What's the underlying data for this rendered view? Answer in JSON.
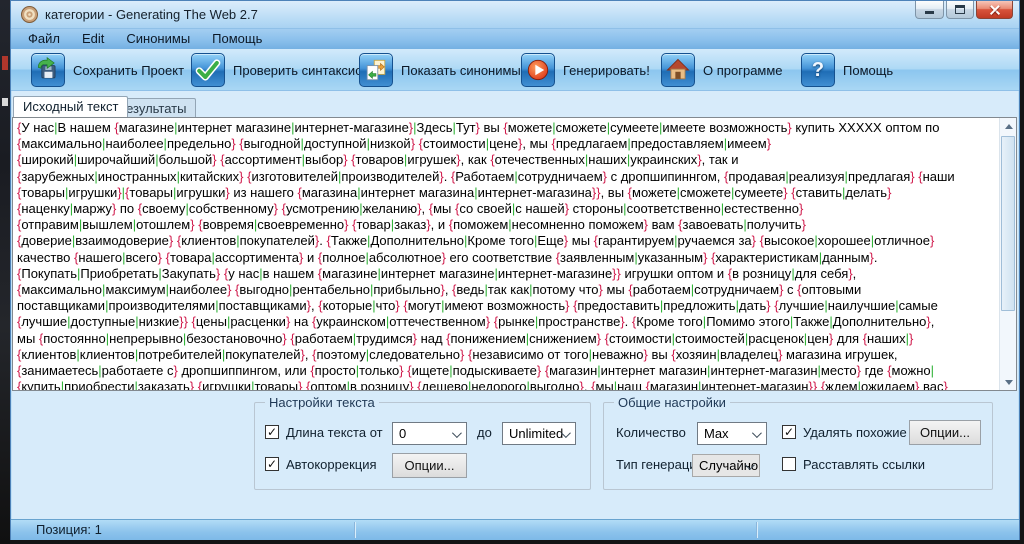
{
  "window": {
    "title": "категории - Generating The Web 2.7"
  },
  "menu": {
    "items": [
      {
        "label": "Файл"
      },
      {
        "label": "Edit"
      },
      {
        "label": "Синонимы"
      },
      {
        "label": "Помощь"
      }
    ]
  },
  "toolbar": {
    "buttons": [
      {
        "label": "Сохранить Проект",
        "icon": "save-icon"
      },
      {
        "label": "Проверить синтаксис",
        "icon": "check-syntax-icon"
      },
      {
        "label": "Показать синонимы",
        "icon": "synonyms-icon"
      },
      {
        "label": "Генерировать!",
        "icon": "generate-icon"
      },
      {
        "label": "О программе",
        "icon": "about-icon"
      },
      {
        "label": "Помощь",
        "icon": "help-icon"
      }
    ]
  },
  "tabs": [
    {
      "label": "Исходный текст",
      "active": true
    },
    {
      "label": "Результаты",
      "active": false
    }
  ],
  "editor": {
    "lines": [
      "{У нас|В нашем {магазине|интернет магазине|интернет-магазине}|Здесь|Тут} вы {можете|сможете|сумеете|имеете возможность} купить XXXXX оптом по",
      "{максимально|наиболее|предельно} {выгодной|доступной|низкой} {стоимости|цене}, мы {предлагаем|предоставляем|имеем}",
      "{широкий|широчайший|большой} {ассортимент|выбор} {товаров|игрушек}, как {отечественных|наших|украинских}, так и",
      "{зарубежных|иностранных|китайских} {изготовителей|производителей}. {Работаем|сотрудничаем} с дропшипиннгом, {продавая|реализуя|предлагая} {наши",
      "{товары|игрушки}|{товары|игрушки} из нашего {магазина|интернет магазина|интернет-магазина}}, вы {можете|сможете|сумеете} {ставить|делать}",
      "{наценку|маржу} по {своему|собственному} {усмотрению|желанию}, {мы {со своей|с нашей} стороны|соответственно|естественно}",
      "{отправим|вышлем|отошлем} {вовремя|своевременно} {товар|заказ}, и {поможем|несомненно поможем} вам {завоевать|получить}",
      "{доверие|взаимодоверие} {клиентов|покупателей}. {Также|Дополнительно|Кроме того|Еще} мы {гарантируем|ручаемся за} {высокое|хорошее|отличное}",
      "качество {нашего|всего} {товара|ассортимента} и {полное|абсолютное} его соответствие {заявленным|указанным} {характеристикам|данным}.",
      "{Покупать|Приобретать|Закупать} {у нас|в нашем {магазине|интернет магазине|интернет-магазине}} игрушки оптом и {в розницу|для себя},",
      "{максимально|максимум|наиболее} {выгодно|рентабельно|прибыльно}, {ведь|так как|потому что} мы {работаем|сотрудничаем} с {оптовыми",
      "поставщиками|производителями|поставщиками}, {которые|что} {могут|имеют возможность} {предоставить|предложить|дать} {лучшие|наилучшие|самые",
      "{лучшие|доступные|низкие}} {цены|расценки} на {украинском|оттечественном} {рынке|пространстве}. {Кроме того|Помимо этого|Также|Дополнительно},",
      "мы {постоянно|непрерывно|безостановочно} {работаем|трудимся} над {понижением|снижением} {стоимости|стоимостей|расценок|цен} для {наших|}",
      "{клиентов|клиентов|потребителей|покупателей}, {поэтому|следовательно} {независимо от того|неважно} вы {хозяин|владелец} магазина игрушек,",
      "{занимаетесь|работаете с} дропшиппингом, или {просто|только} {ищете|подыскиваете} {магазин|интернет магазин|интернет-магазин|место} где {можно|",
      "{купить|приобрести|заказать} {игрушки|товары} {оптом|в розницу} {дешево|недорого|выгодно}, {мы|наш {магазин|интернет-магазин}} {ждем|ожидаем} вас}"
    ]
  },
  "settings": {
    "text_group": {
      "title": "Настройки текста",
      "length_label": "Длина текста от",
      "length_from": "0",
      "to_label": "до",
      "length_to": "Unlimited",
      "autocorrect_label": "Автокоррекция",
      "options_button": "Опции..."
    },
    "general_group": {
      "title": "Общие настройки",
      "count_label": "Количество",
      "count_value": "Max",
      "remove_similar_label": "Удалять похожие",
      "options_button": "Опции...",
      "gen_type_label": "Тип генерации",
      "gen_type_value": "Случайно",
      "links_label": "Расставлять ссылки"
    }
  },
  "statusbar": {
    "position": "Позиция: 1"
  },
  "colors": {
    "brace": "#d01b4c",
    "pipe": "#2eb135",
    "accent_blue": "#1f6db5",
    "client_bg": "#d7ebfa"
  }
}
